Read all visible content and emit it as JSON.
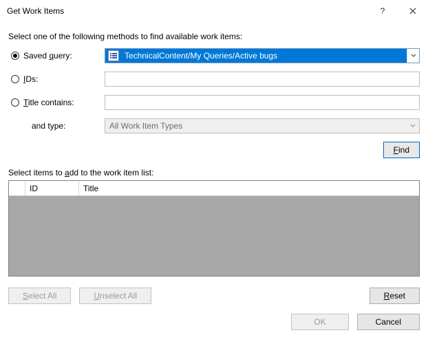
{
  "window": {
    "title": "Get Work Items"
  },
  "instruction": "Select one of the following methods to find available work items:",
  "options": {
    "saved_query": {
      "label_pre": "Saved ",
      "label_u": "q",
      "label_post": "uery:",
      "value": "TechnicalContent/My Queries/Active bugs"
    },
    "ids": {
      "label_u": "I",
      "label_post": "Ds:"
    },
    "title_contains": {
      "label_u": "T",
      "label_post": "itle contains:"
    },
    "and_type": {
      "label": "and type:",
      "value": "All Work Item Types"
    }
  },
  "buttons": {
    "find_pre": "",
    "find_u": "F",
    "find_post": "ind",
    "select_all_u": "S",
    "select_all_post": "elect All",
    "unselect_all_u": "U",
    "unselect_all_post": "nselect All",
    "reset_u": "R",
    "reset_post": "eset",
    "ok": "OK",
    "cancel": "Cancel"
  },
  "select_items_pre": "Select items to ",
  "select_items_u": "a",
  "select_items_post": "dd to the work item list:",
  "columns": {
    "id": "ID",
    "title": "Title"
  }
}
